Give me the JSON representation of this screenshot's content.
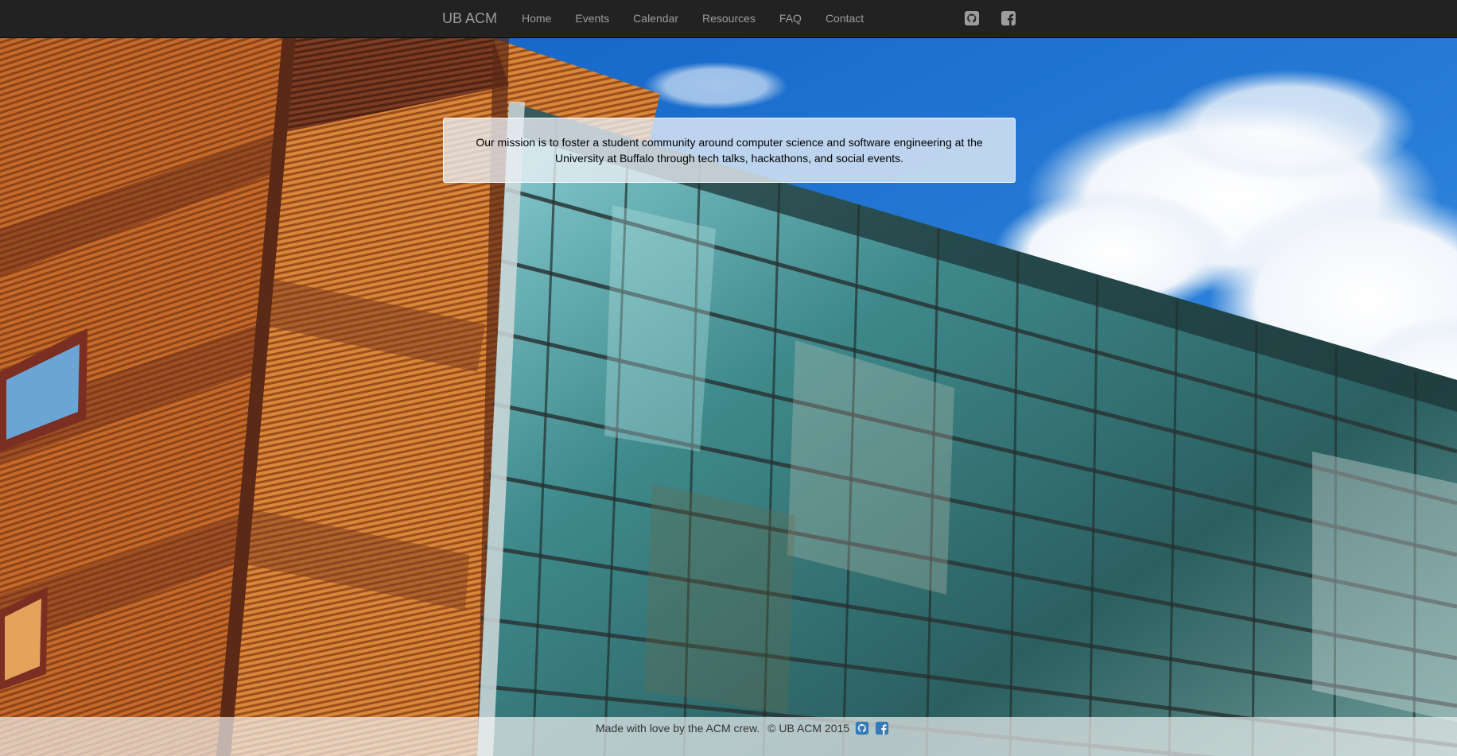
{
  "navbar": {
    "brand": "UB ACM",
    "links": [
      "Home",
      "Events",
      "Calendar",
      "Resources",
      "FAQ",
      "Contact"
    ],
    "social": [
      {
        "icon": "github-icon"
      },
      {
        "icon": "facebook-icon"
      }
    ]
  },
  "mission": {
    "text": "Our mission is to foster a student community around computer science and software engineering at the University at Buffalo through tech talks, hackathons, and social events."
  },
  "footer": {
    "made_with": "Made with love by the ACM crew.",
    "copyright": "© UB ACM 2015",
    "icons": [
      "github-icon",
      "facebook-icon"
    ]
  },
  "colors": {
    "navbar_bg": "#222222",
    "nav_text": "#9d9d9d",
    "footer_icon": "#337ab7"
  }
}
